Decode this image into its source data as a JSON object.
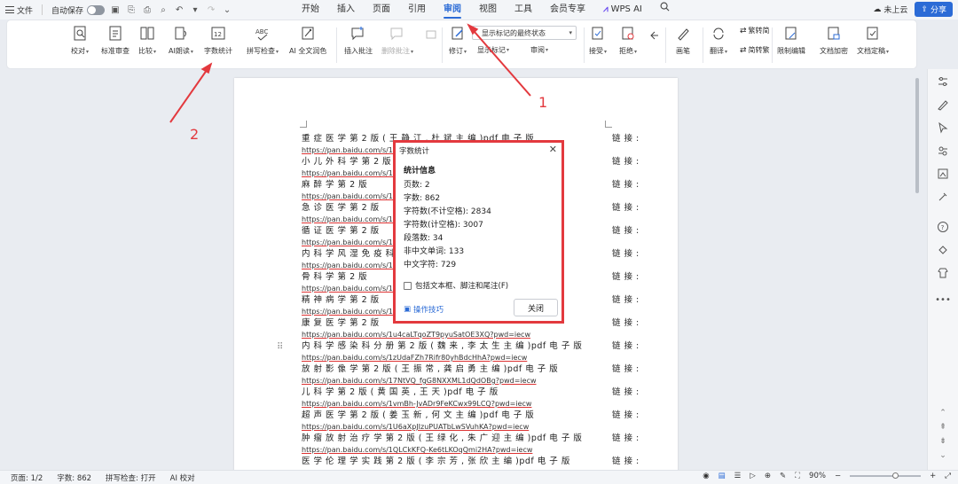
{
  "titlebar": {
    "file_label": "文件",
    "autosave_label": "自动保存",
    "tabs": [
      "开始",
      "插入",
      "页面",
      "引用",
      "审阅",
      "视图",
      "工具",
      "会员专享",
      "WPS AI"
    ],
    "active_tab": "审阅",
    "cloud_label": "未上云",
    "share_label": "分享"
  },
  "ribbon": {
    "proofread": "校对",
    "standard_review": "标准审查",
    "compare": "比较",
    "ai_read": "AI朗读",
    "word_count": "字数统计",
    "spell_check": "拼写检查",
    "ai_polish": "AI 全文润色",
    "insert_comment": "插入批注",
    "delete_comment": "删除批注",
    "revise": "修订",
    "markup_state": "显示标记的最终状态",
    "show_markup": "显示标记",
    "review_pane": "审阅",
    "accept": "接受",
    "reject": "拒绝",
    "ink": "画笔",
    "translate": "翻译",
    "to_traditional": "繁转简",
    "to_simplified": "简转繁",
    "restrict_edit": "限制编辑",
    "doc_encrypt": "文档加密",
    "doc_finalize": "文档定稿"
  },
  "document": {
    "lines_left": [
      {
        "t": "重 症 医 学   第 2 版   ( 王 静 江 , 杜 斌 主 编 )pdf  电 子 版",
        "url": false
      },
      {
        "t": "https://pan.baidu.com/s/1uz",
        "url": true
      },
      {
        "t": "小 儿 外 科 学   第 2 版",
        "url": false
      },
      {
        "t": "https://pan.baidu.com/s/1G",
        "url": true
      },
      {
        "t": "麻 醉 学   第 2 版",
        "url": false
      },
      {
        "t": "https://pan.baidu.com/s/1_i",
        "url": true
      },
      {
        "t": "急 诊 医 学   第 2 版",
        "url": false
      },
      {
        "t": "https://pan.baidu.com/s/1X",
        "url": true
      },
      {
        "t": "循 证 医 学   第 2 版",
        "url": false
      },
      {
        "t": "https://pan.baidu.com/s/1h",
        "url": true
      },
      {
        "t": "内 科 学   风 湿 免 疫 科 分",
        "url": false
      },
      {
        "t": "https://pan.baidu.com/s/1rL",
        "url": true
      },
      {
        "t": "骨 科 学   第 2 版",
        "url": false
      },
      {
        "t": "https://pan.baidu.com/s/1ul",
        "url": true
      },
      {
        "t": "精 神 病 学   第 2 版",
        "url": false
      },
      {
        "t": "https://pan.baidu.com/s/1F",
        "url": true
      },
      {
        "t": "康 复 医 学   第 2 版",
        "url": false
      },
      {
        "t": "https://pan.baidu.com/s/1u4caLTqoZT9pyuSatOE3XQ?pwd=iecw",
        "url": true
      },
      {
        "t": "内 科 学   感 染 科 分 册   第 2 版   ( 魏 来 , 李 太 生 主 编 )pdf  电 子 版",
        "url": false
      },
      {
        "t": "https://pan.baidu.com/s/1zUdaFZh7Rifr80yhBdcHhA?pwd=iecw",
        "url": true
      },
      {
        "t": "放 射 影 像 学   第 2 版   ( 王 振 常 , 龚 启 勇 主 编 )pdf  电 子 版",
        "url": false
      },
      {
        "t": "https://pan.baidu.com/s/17NtVQ_fgG8NXXML1dQdOBg?pwd=iecw",
        "url": true
      },
      {
        "t": "儿 科 学    第 2 版    ( 黄 国 英 , 王 天 )pdf   电 子 版",
        "url": false
      },
      {
        "t": "https://pan.baidu.com/s/1vmBh-JvADr9FeKCwx99LCQ?pwd=iecw",
        "url": true
      },
      {
        "t": "超 声 医 学    第 2 版    ( 姜 玉 新 , 何 文 主 编 )pdf  电 子 版",
        "url": false
      },
      {
        "t": "https://pan.baidu.com/s/1U6aXpJIzuPUATbLwSVuhKA?pwd=iecw",
        "url": true
      },
      {
        "t": "肿 瘤 放 射 治 疗 学   第 2 版   ( 王 绿 化 , 朱 广 迎 主 编 )pdf  电 子 版",
        "url": false
      },
      {
        "t": "https://pan.baidu.com/s/1QLCkKFQ-Ke6tLKOqQmi2HA?pwd=iecw",
        "url": true
      },
      {
        "t": "医 学 伦 理 学 实 践   第 2 版   ( 李 宗 芳 , 张 欣 主 编 )pdf  电 子 版",
        "url": false
      }
    ],
    "lines_right": [
      "链 接 :",
      "",
      "链 接 :",
      "",
      "链 接 :",
      "",
      "链 接 :",
      "",
      "链 接 :",
      "",
      "链 接 :",
      "",
      "链 接 :",
      "",
      "链 接 :",
      "",
      "链 接 :",
      "",
      "链 接 :",
      "",
      "链 接 :",
      "",
      "链 接 :",
      "",
      "链 接 :",
      "",
      "链 接 :",
      "",
      "链 接 :"
    ]
  },
  "dialog": {
    "title": "字数统计",
    "heading": "统计信息",
    "stats": [
      "页数: 2",
      "字数: 862",
      "字符数(不计空格): 2834",
      "字符数(计空格): 3007",
      "段落数: 34",
      "非中文单词: 133",
      "中文字符: 729"
    ],
    "checkbox_label": "包括文本框、脚注和尾注(F)",
    "tips_label": "操作技巧",
    "close_label": "关闭"
  },
  "statusbar": {
    "page": "页面: 1/2",
    "words": "字数: 862",
    "spell": "拼写检查: 打开",
    "ai_proof": "AI 校对",
    "zoom": "90%"
  },
  "annotations": {
    "num1": "1",
    "num2": "2"
  },
  "colors": {
    "accent": "#2b6bd6",
    "highlight": "#e3393e"
  }
}
